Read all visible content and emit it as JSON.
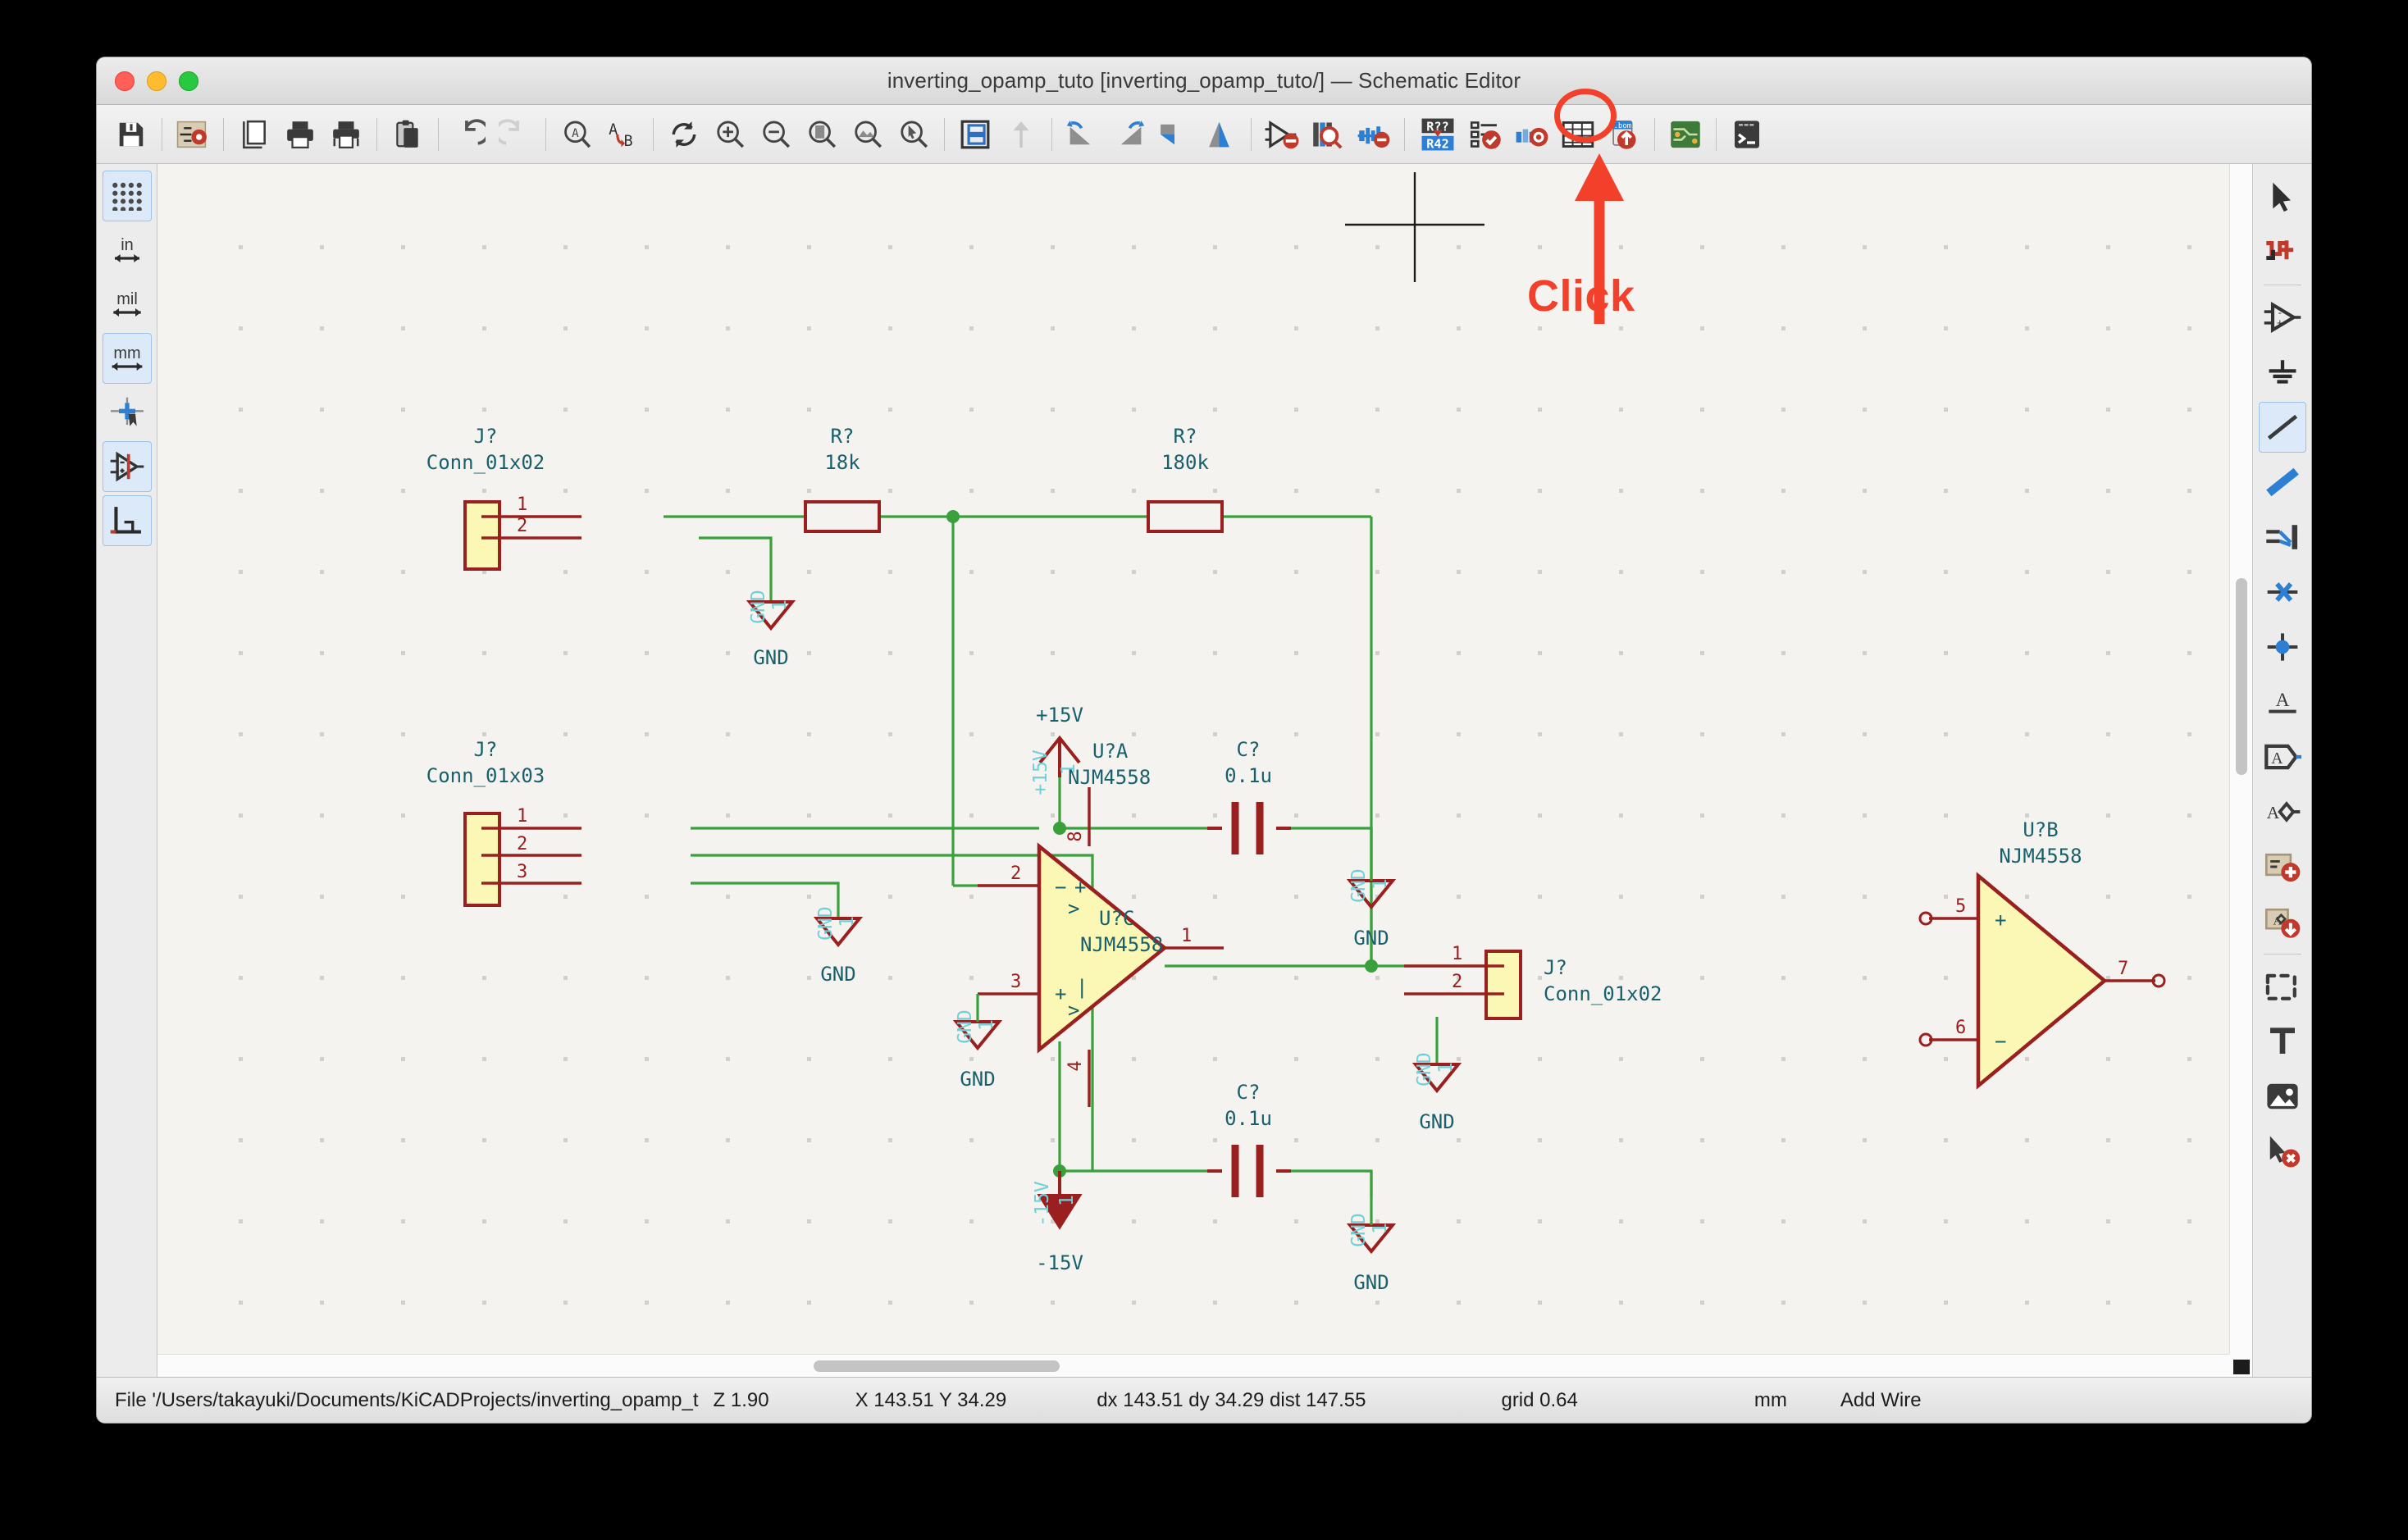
{
  "window": {
    "title": "inverting_opamp_tuto [inverting_opamp_tuto/] — Schematic Editor",
    "traffic_lights": [
      "close",
      "minimize",
      "zoom"
    ]
  },
  "annotation": {
    "click_label": "Click",
    "target_icon": "annotate-schematic-icon",
    "highlight_color": "#f2402a",
    "icon_top_text": "R??",
    "icon_bottom_text": "R42"
  },
  "toolbar": {
    "items": [
      {
        "name": "save-icon",
        "label": "Save"
      },
      {
        "name": "schematic-setup-icon",
        "label": "Schematic Setup"
      },
      {
        "name": "page-settings-icon",
        "label": "Page Settings"
      },
      {
        "name": "print-icon",
        "label": "Print"
      },
      {
        "name": "plot-icon",
        "label": "Plot"
      },
      {
        "name": "paste-icon",
        "label": "Paste"
      },
      {
        "name": "undo-icon",
        "label": "Undo"
      },
      {
        "name": "redo-icon",
        "label": "Redo"
      },
      {
        "name": "find-icon",
        "label": "Find"
      },
      {
        "name": "find-replace-icon",
        "label": "Find and Replace"
      },
      {
        "name": "refresh-icon",
        "label": "Refresh"
      },
      {
        "name": "zoom-in-icon",
        "label": "Zoom In"
      },
      {
        "name": "zoom-out-icon",
        "label": "Zoom Out"
      },
      {
        "name": "zoom-fit-page-icon",
        "label": "Zoom to Fit Page"
      },
      {
        "name": "zoom-fit-objects-icon",
        "label": "Zoom to Objects"
      },
      {
        "name": "zoom-selection-icon",
        "label": "Zoom to Selection"
      },
      {
        "name": "hierarchy-navigator-icon",
        "label": "Show Hierarchy Navigator"
      },
      {
        "name": "leave-sheet-icon",
        "label": "Leave Sheet"
      },
      {
        "name": "rotate-ccw-icon",
        "label": "Rotate Counterclockwise"
      },
      {
        "name": "rotate-cw-icon",
        "label": "Rotate Clockwise"
      },
      {
        "name": "mirror-horizontal-icon",
        "label": "Mirror Horizontally"
      },
      {
        "name": "mirror-vertical-icon",
        "label": "Mirror Vertically"
      },
      {
        "name": "symbol-editor-icon",
        "label": "Symbol Editor"
      },
      {
        "name": "symbol-library-browser-icon",
        "label": "Symbol Library Browser"
      },
      {
        "name": "simulator-icon",
        "label": "Simulator"
      },
      {
        "name": "annotate-schematic-icon",
        "label": "Annotate Schematic"
      },
      {
        "name": "erc-icon",
        "label": "Electrical Rules Checker"
      },
      {
        "name": "assign-footprints-icon",
        "label": "Assign Footprints"
      },
      {
        "name": "symbol-fields-table-icon",
        "label": "Symbol Fields Table"
      },
      {
        "name": "generate-bom-icon",
        "label": "Generate BOM"
      },
      {
        "name": "open-pcb-editor-icon",
        "label": "Open PCB Editor"
      },
      {
        "name": "scripting-console-icon",
        "label": "Scripting Console"
      }
    ]
  },
  "left_toolbar": {
    "items": [
      {
        "name": "toggle-grid-icon",
        "label": "Toggle Grid Display",
        "active": true
      },
      {
        "name": "units-inches-icon",
        "label": "in",
        "active": false
      },
      {
        "name": "units-mils-icon",
        "label": "mil",
        "active": false
      },
      {
        "name": "units-mm-icon",
        "label": "mm",
        "active": true
      },
      {
        "name": "full-crosshair-icon",
        "label": "Toggle Full-Window Crosshair",
        "active": false
      },
      {
        "name": "hidden-pins-icon",
        "label": "Show Hidden Pins",
        "active": true
      },
      {
        "name": "wire-bus-90-icon",
        "label": "Force H/V Wires and Buses",
        "active": true
      }
    ]
  },
  "right_toolbar": {
    "items": [
      {
        "name": "select-tool-icon",
        "label": "Select Item",
        "active": false
      },
      {
        "name": "highlight-net-icon",
        "label": "Highlight Net",
        "active": false
      },
      {
        "name": "add-symbol-icon",
        "label": "Add Symbol",
        "active": false
      },
      {
        "name": "add-power-icon",
        "label": "Add Power Port",
        "active": false
      },
      {
        "name": "add-wire-icon",
        "label": "Add Wire",
        "active": true
      },
      {
        "name": "add-bus-icon",
        "label": "Add Bus",
        "active": false
      },
      {
        "name": "add-wire-to-bus-entry-icon",
        "label": "Add Wire to Bus Entry",
        "active": false
      },
      {
        "name": "add-no-connect-icon",
        "label": "Add No Connect Flag",
        "active": false
      },
      {
        "name": "add-junction-icon",
        "label": "Add Junction",
        "active": false
      },
      {
        "name": "add-net-label-icon",
        "label": "Add Net Label",
        "active": false
      },
      {
        "name": "add-global-label-icon",
        "label": "Add Global Label",
        "active": false
      },
      {
        "name": "add-hier-label-icon",
        "label": "Add Hierarchical Label",
        "active": false
      },
      {
        "name": "add-sheet-icon",
        "label": "Add Hierarchical Sheet",
        "active": false
      },
      {
        "name": "import-sheet-pin-icon",
        "label": "Import Sheet Pin",
        "active": false
      },
      {
        "name": "draw-lines-icon",
        "label": "Draw Lines",
        "active": false
      },
      {
        "name": "add-text-icon",
        "label": "Add Text",
        "active": false
      },
      {
        "name": "add-image-icon",
        "label": "Add Bitmap Image",
        "active": false
      },
      {
        "name": "delete-tool-icon",
        "label": "Delete Items",
        "active": false
      }
    ]
  },
  "statusbar": {
    "file": "File '/Users/takayuki/Documents/KiCADProjects/inverting_opamp_t",
    "zoom": "Z 1.90",
    "coords": "X 143.51  Y 34.29",
    "delta": "dx 143.51  dy 34.29  dist 147.55",
    "grid": "grid 0.64",
    "units": "mm",
    "tool": "Add Wire"
  },
  "schematic": {
    "components": [
      {
        "ref": "J?",
        "value": "Conn_01x02",
        "type": "connector",
        "pins": [
          "1",
          "2"
        ]
      },
      {
        "ref": "R?",
        "value": "18k",
        "type": "resistor"
      },
      {
        "ref": "R?",
        "value": "180k",
        "type": "resistor"
      },
      {
        "ref": "J?",
        "value": "Conn_01x03",
        "type": "connector",
        "pins": [
          "1",
          "2",
          "3"
        ]
      },
      {
        "ref": "C?",
        "value": "0.1u",
        "type": "capacitor"
      },
      {
        "ref": "C?",
        "value": "0.1u",
        "type": "capacitor"
      },
      {
        "ref": "U?A",
        "value": "NJM4558",
        "type": "opamp",
        "pins": [
          "2",
          "3",
          "1",
          "8",
          "4"
        ]
      },
      {
        "ref": "U?C",
        "value": "NJM4558",
        "type": "opamp-power-unit"
      },
      {
        "ref": "U?B",
        "value": "NJM4558",
        "type": "opamp",
        "pins": [
          "5",
          "6",
          "7"
        ]
      },
      {
        "ref": "J?",
        "value": "Conn_01x02",
        "type": "connector",
        "pins": [
          "1",
          "2"
        ]
      }
    ],
    "power_labels": [
      "+15V",
      "-15V",
      "GND",
      "GND",
      "GND",
      "GND",
      "GND"
    ],
    "net_tags": {
      "plus15": "+15V",
      "minus15": "-15V",
      "gnd": "GND",
      "pin_one": "1"
    },
    "texts": {
      "j1_ref": "J?",
      "j1_val": "Conn_01x02",
      "r1_ref": "R?",
      "r1_val": "18k",
      "r2_ref": "R?",
      "r2_val": "180k",
      "j2_ref": "J?",
      "j2_val": "Conn_01x03",
      "c1_ref": "C?",
      "c1_val": "0.1u",
      "c2_ref": "C?",
      "c2_val": "0.1u",
      "ua_ref": "U?A",
      "ua_val": "NJM4558",
      "uc_ref": "U?C",
      "uc_val": "NJM4558",
      "ub_ref": "U?B",
      "ub_val": "NJM4558",
      "j3_ref": "J?",
      "j3_val": "Conn_01x02",
      "gnd": "GND",
      "p15": "+15V",
      "m15": "-15V",
      "pin1": "1",
      "pin2": "2",
      "pin3": "3",
      "pin4": "4",
      "pin5": "5",
      "pin6": "6",
      "pin7": "7",
      "pin8": "8",
      "one": "1"
    },
    "colors": {
      "wire": "#39a03c",
      "component_outline": "#9a2020",
      "component_fill": "#fbf7b5",
      "field_text": "#18606b",
      "pin_text": "#9a2020",
      "power_text": "#6fd1d8",
      "background": "#f4f3ef",
      "grid_dot": "#c9c9c4"
    }
  }
}
